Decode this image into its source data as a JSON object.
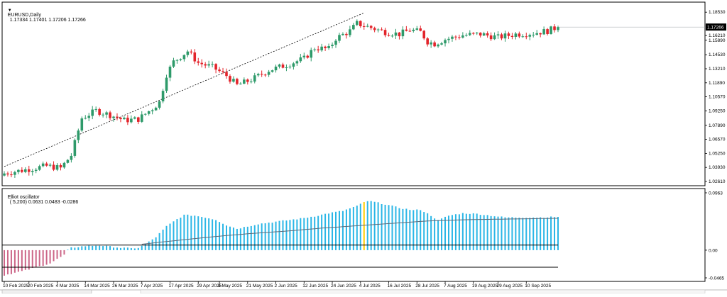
{
  "header": {
    "symbol_label": "EURUSD,Daily",
    "ohlc_label": "1.17334 1.17401 1.17206 1.17266",
    "dropdown_glyph": "▼"
  },
  "oscillator_header": {
    "label": "Elliot oscillator",
    "params_label": "( 5,200) 0.0631 0.0483 -0.0286"
  },
  "colors": {
    "bull": "#2e9a6a",
    "bear": "#e3242b",
    "osc_pos": "#2ab6e6",
    "osc_neg": "#cc6688",
    "osc_highlight": "#ffcc00",
    "signal_line": "#5a6b7b",
    "level_line": "#000000",
    "trendline": "#000000",
    "price_tag_bg": "#000000",
    "grid_border": "#000000"
  },
  "chart_data": [
    {
      "type": "candlestick",
      "title": "EURUSD,Daily",
      "subtitle": "1.17334 1.17401 1.17206 1.17266",
      "ylim": [
        1.0261,
        1.1901
      ],
      "y_ticks": [
        "1.18530",
        "1.16210",
        "1.15890",
        "1.14530",
        "1.13210",
        "1.11890",
        "1.10570",
        "1.09250",
        "1.07890",
        "1.06570",
        "1.05250",
        "1.03930",
        "1.02610"
      ],
      "current_price": "1.17266",
      "x_ticks": [
        "10 Feb 2025",
        "20 Feb 2025",
        "4 Mar 2025",
        "14 Mar 2025",
        "26 Mar 2025",
        "7 Apr 2025",
        "17 Apr 2025",
        "29 Apr 2025",
        "9 May 2025",
        "21 May 2025",
        "2 Jun 2025",
        "12 Jun 2025",
        "24 Jun 2025",
        "4 Jul 2025",
        "16 Jul 2025",
        "28 Jul 2025",
        "7 Aug 2025",
        "19 Aug 2025",
        "29 Aug 2025",
        "10 Sep 2025"
      ],
      "anchors": [
        [
          0,
          1.035
        ],
        [
          12,
          1.042
        ],
        [
          16,
          1.04
        ],
        [
          19,
          1.052
        ],
        [
          22,
          1.087
        ],
        [
          26,
          1.094
        ],
        [
          30,
          1.09
        ],
        [
          34,
          1.085
        ],
        [
          38,
          1.086
        ],
        [
          42,
          1.096
        ],
        [
          44,
          1.102
        ],
        [
          46,
          1.128
        ],
        [
          48,
          1.14
        ],
        [
          52,
          1.15
        ],
        [
          55,
          1.139
        ],
        [
          59,
          1.135
        ],
        [
          63,
          1.127
        ],
        [
          66,
          1.118
        ],
        [
          70,
          1.123
        ],
        [
          75,
          1.132
        ],
        [
          80,
          1.137
        ],
        [
          85,
          1.143
        ],
        [
          88,
          1.153
        ],
        [
          92,
          1.152
        ],
        [
          94,
          1.162
        ],
        [
          98,
          1.169
        ],
        [
          100,
          1.176
        ],
        [
          104,
          1.172
        ],
        [
          108,
          1.168
        ],
        [
          112,
          1.166
        ],
        [
          115,
          1.17
        ],
        [
          118,
          1.168
        ],
        [
          120,
          1.159
        ],
        [
          122,
          1.157
        ],
        [
          125,
          1.161
        ],
        [
          130,
          1.165
        ],
        [
          135,
          1.166
        ],
        [
          140,
          1.163
        ],
        [
          145,
          1.166
        ],
        [
          150,
          1.167
        ],
        [
          154,
          1.169
        ],
        [
          157,
          1.1727
        ]
      ],
      "trendline": [
        [
          0,
          1.0415
        ],
        [
          102,
          1.186
        ]
      ]
    },
    {
      "type": "bar",
      "title": "Elliot oscillator",
      "subtitle": "( 5,200) 0.0631 0.0483 -0.0286",
      "ylim": [
        -0.0465,
        0.0963
      ],
      "y_ticks": [
        "0.0963",
        "0.00",
        "-0.0465"
      ],
      "upper_level": 0.0086,
      "lower_level": -0.0286,
      "osc_anchors": [
        [
          0,
          -0.042
        ],
        [
          6,
          -0.034
        ],
        [
          13,
          -0.022
        ],
        [
          17,
          -0.008
        ],
        [
          18,
          0.0
        ],
        [
          19,
          0.004
        ],
        [
          23,
          0.007
        ],
        [
          27,
          0.008
        ],
        [
          30,
          0.006
        ],
        [
          33,
          0.004
        ],
        [
          36,
          0.003
        ],
        [
          38,
          0.004
        ],
        [
          40,
          0.01
        ],
        [
          43,
          0.022
        ],
        [
          46,
          0.04
        ],
        [
          49,
          0.052
        ],
        [
          51,
          0.059
        ],
        [
          54,
          0.058
        ],
        [
          57,
          0.055
        ],
        [
          60,
          0.051
        ],
        [
          63,
          0.042
        ],
        [
          66,
          0.036
        ],
        [
          69,
          0.04
        ],
        [
          72,
          0.044
        ],
        [
          76,
          0.047
        ],
        [
          80,
          0.05
        ],
        [
          84,
          0.053
        ],
        [
          88,
          0.057
        ],
        [
          92,
          0.062
        ],
        [
          96,
          0.066
        ],
        [
          100,
          0.074
        ],
        [
          102,
          0.081
        ],
        [
          104,
          0.082
        ],
        [
          108,
          0.077
        ],
        [
          112,
          0.071
        ],
        [
          116,
          0.067
        ],
        [
          118,
          0.068
        ],
        [
          121,
          0.058
        ],
        [
          123,
          0.05
        ],
        [
          126,
          0.058
        ],
        [
          130,
          0.062
        ],
        [
          134,
          0.061
        ],
        [
          138,
          0.058
        ],
        [
          142,
          0.055
        ],
        [
          147,
          0.055
        ],
        [
          152,
          0.055
        ],
        [
          157,
          0.056
        ]
      ],
      "signal_anchors": [
        [
          39,
          0.01
        ],
        [
          50,
          0.017
        ],
        [
          60,
          0.023
        ],
        [
          70,
          0.028
        ],
        [
          80,
          0.032
        ],
        [
          90,
          0.037
        ],
        [
          100,
          0.041
        ],
        [
          110,
          0.045
        ],
        [
          120,
          0.049
        ],
        [
          130,
          0.051
        ],
        [
          140,
          0.052
        ],
        [
          157,
          0.0535
        ]
      ],
      "highlight_index": 102
    }
  ]
}
